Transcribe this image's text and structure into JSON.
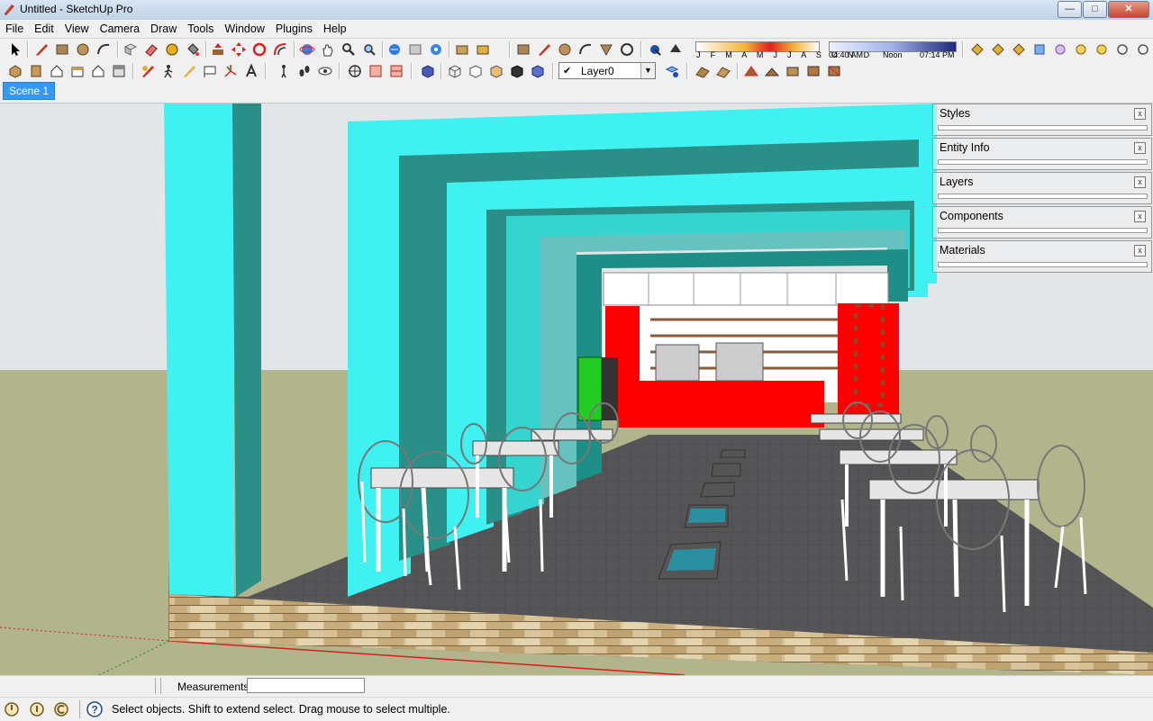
{
  "window": {
    "title": "Untitled - SketchUp Pro",
    "minimize": "—",
    "maximize": "□",
    "close": "✕"
  },
  "menu": [
    "File",
    "Edit",
    "View",
    "Camera",
    "Draw",
    "Tools",
    "Window",
    "Plugins",
    "Help"
  ],
  "shadow_settings": {
    "months": "J F M A M J J A S O N D",
    "time_start": "04:40 AM",
    "time_mid": "Noon",
    "time_end": "07:14 PM"
  },
  "layer_select": {
    "checkmark": "✔",
    "value": "Layer0"
  },
  "scenes": {
    "active": "Scene 1"
  },
  "trays": [
    {
      "label": "Styles",
      "close": "x"
    },
    {
      "label": "Entity Info",
      "close": "x"
    },
    {
      "label": "Layers",
      "close": "x"
    },
    {
      "label": "Components",
      "close": "x"
    },
    {
      "label": "Materials",
      "close": "x"
    }
  ],
  "measurements": {
    "label": "Measurements",
    "value": ""
  },
  "status": {
    "text": "Select objects. Shift to extend select. Drag mouse to select multiple."
  },
  "colors": {
    "cyan": "#3ff1f0",
    "teal_dark": "#2a8f86",
    "floor": "#5a5a5c",
    "counter_red": "#ff0000",
    "brick": "#d9c49a",
    "sky": "#e3e6e8",
    "ground": "#b2b48c",
    "selection_blue": "#3399ff"
  }
}
